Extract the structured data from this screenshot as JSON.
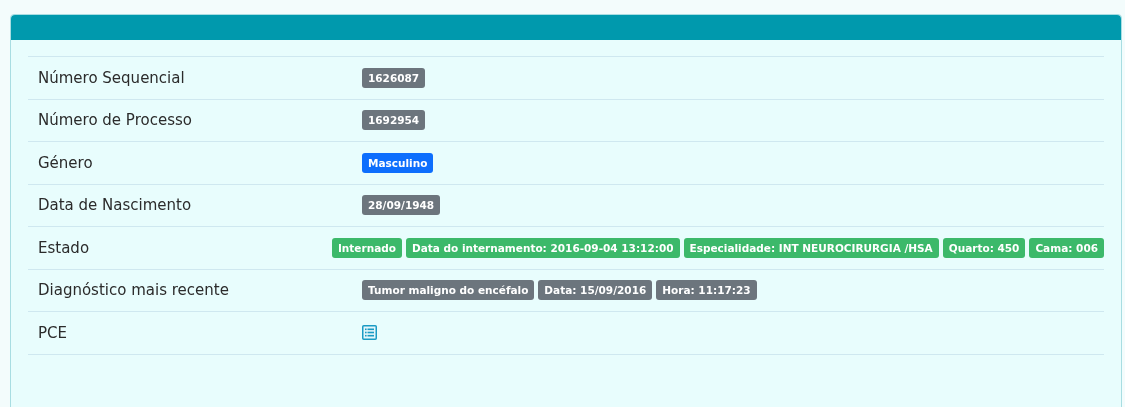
{
  "rows": [
    {
      "label": "Número Sequencial",
      "kind": "badges",
      "badges": [
        {
          "text": "1626087",
          "color": "#6c757d"
        }
      ]
    },
    {
      "label": "Número de Processo",
      "kind": "badges",
      "badges": [
        {
          "text": "1692954",
          "color": "#6c757d"
        }
      ]
    },
    {
      "label": "Género",
      "kind": "badges",
      "badges": [
        {
          "text": "Masculino",
          "color": "#0d6efd"
        }
      ]
    },
    {
      "label": "Data de Nascimento",
      "kind": "badges",
      "badges": [
        {
          "text": "28/09/1948",
          "color": "#6c757d"
        }
      ]
    },
    {
      "label": "Estado",
      "kind": "badges",
      "badges": [
        {
          "text": "Internado",
          "color": "#3cb96a"
        },
        {
          "text": "Data do internamento: 2016-09-04 13:12:00",
          "color": "#3cb96a"
        },
        {
          "text": "Especialidade: INT NEUROCIRURGIA /HSA",
          "color": "#3cb96a"
        },
        {
          "text": "Quarto: 450",
          "color": "#3cb96a"
        },
        {
          "text": "Cama: 006",
          "color": "#3cb96a"
        }
      ]
    },
    {
      "label": "Diagnóstico mais recente",
      "kind": "badges",
      "badges": [
        {
          "text": "Tumor maligno do encéfalo",
          "color": "#6c757d"
        },
        {
          "text": "Data: 15/09/2016",
          "color": "#6c757d"
        },
        {
          "text": "Hora: 11:17:23",
          "color": "#6c757d"
        }
      ]
    },
    {
      "label": "PCE",
      "kind": "icon"
    }
  ]
}
